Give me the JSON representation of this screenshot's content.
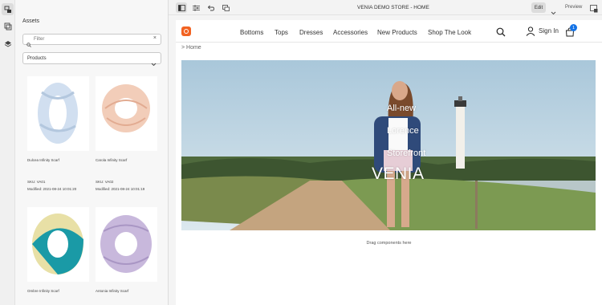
{
  "panel": {
    "title": "Assets",
    "filter_placeholder": "Filter",
    "category": "Products"
  },
  "assets": [
    {
      "name": "Dulcea Infinity Scarf",
      "sku": "SKU: VA01",
      "modified": "Modified: 2021-08-24 10:01:20",
      "color": "#c9d9ea"
    },
    {
      "name": "Carola Infinity Scarf",
      "sku": "SKU: VA02",
      "modified": "Modified: 2021-08-24 10:01:19",
      "color": "#f0c8b4"
    },
    {
      "name": "Ombre Infinity Scarf",
      "sku": "",
      "modified": "",
      "color": "#1a9aa6"
    },
    {
      "name": "Antonia Infinity Scarf",
      "sku": "",
      "modified": "",
      "color": "#c3b2d8"
    }
  ],
  "topbar": {
    "title": "VENIA DEMO STORE - HOME",
    "edit_label": "Edit",
    "preview_label": "Preview"
  },
  "site": {
    "nav": [
      "Bottoms",
      "Tops",
      "Dresses",
      "Accessories",
      "New Products",
      "Shop The Look"
    ],
    "signin_label": "Sign In",
    "cart_count": "1",
    "breadcrumb": "> Home",
    "hero_lines": [
      "All-new",
      "Lorence",
      "Storefront"
    ],
    "hero_brand": "VENIA"
  },
  "dropzone_label": "Drag components here",
  "colors": {
    "accent": "#1473e6",
    "logo": "#f26322"
  }
}
